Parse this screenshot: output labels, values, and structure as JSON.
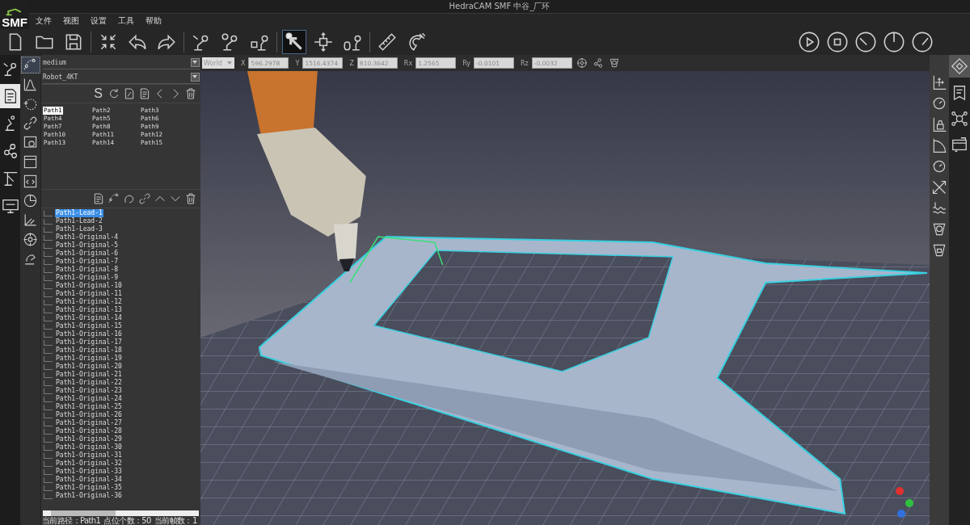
{
  "window": {
    "title": "HedraCAM SMF 中谷_厂环",
    "logo": "SMF"
  },
  "menu": [
    "文件",
    "视图",
    "设置",
    "工具",
    "帮助"
  ],
  "toolbar": [
    {
      "selected": false
    },
    {
      "selected": false
    },
    {
      "selected": false
    },
    {
      "selected": false
    },
    {
      "selected": false
    },
    {
      "selected": false
    },
    {
      "selected": false
    },
    {
      "selected": false
    },
    {
      "selected": false
    },
    {
      "selected": true
    },
    {
      "selected": false
    },
    {
      "selected": false
    },
    {
      "selected": false
    },
    {
      "selected": false
    }
  ],
  "left_rail": [
    {
      "selected": false
    },
    {
      "selected": true
    },
    {
      "selected": false
    },
    {
      "selected": false
    },
    {
      "selected": false
    },
    {
      "selected": false
    }
  ],
  "coords": {
    "frame": "World",
    "fields": [
      {
        "label": "X",
        "value": "596.2978"
      },
      {
        "label": "Y",
        "value": "1516.4374"
      },
      {
        "label": "Z",
        "value": "810.3642"
      },
      {
        "label": "Rx",
        "value": "1.2565"
      },
      {
        "label": "Ry",
        "value": "-0.0101"
      },
      {
        "label": "Rz",
        "value": "-0.0032"
      }
    ]
  },
  "panel": {
    "program": "medium",
    "robot": "Robot_4KT",
    "path_tool_label": "S",
    "paths": [
      {
        "label": "Path1",
        "selected": true
      },
      {
        "label": "Path2",
        "selected": false
      },
      {
        "label": "Path3",
        "selected": false
      },
      {
        "label": "Path4",
        "selected": false
      },
      {
        "label": "Path5",
        "selected": false
      },
      {
        "label": "Path6",
        "selected": false
      },
      {
        "label": "Path7",
        "selected": false
      },
      {
        "label": "Path8",
        "selected": false
      },
      {
        "label": "Path9",
        "selected": false
      },
      {
        "label": "Path10",
        "selected": false
      },
      {
        "label": "Path11",
        "selected": false
      },
      {
        "label": "Path12",
        "selected": false
      },
      {
        "label": "Path13",
        "selected": false
      },
      {
        "label": "Path14",
        "selected": false
      },
      {
        "label": "Path15",
        "selected": false
      }
    ],
    "points": [
      {
        "label": "Path1-Lead-1",
        "selected": true
      },
      {
        "label": "Path1-Lead-2",
        "selected": false
      },
      {
        "label": "Path1-Lead-3",
        "selected": false
      },
      {
        "label": "Path1-Original-4",
        "selected": false
      },
      {
        "label": "Path1-Original-5",
        "selected": false
      },
      {
        "label": "Path1-Original-6",
        "selected": false
      },
      {
        "label": "Path1-Original-7",
        "selected": false
      },
      {
        "label": "Path1-Original-8",
        "selected": false
      },
      {
        "label": "Path1-Original-9",
        "selected": false
      },
      {
        "label": "Path1-Original-10",
        "selected": false
      },
      {
        "label": "Path1-Original-11",
        "selected": false
      },
      {
        "label": "Path1-Original-12",
        "selected": false
      },
      {
        "label": "Path1-Original-13",
        "selected": false
      },
      {
        "label": "Path1-Original-14",
        "selected": false
      },
      {
        "label": "Path1-Original-15",
        "selected": false
      },
      {
        "label": "Path1-Original-16",
        "selected": false
      },
      {
        "label": "Path1-Original-17",
        "selected": false
      },
      {
        "label": "Path1-Original-18",
        "selected": false
      },
      {
        "label": "Path1-Original-19",
        "selected": false
      },
      {
        "label": "Path1-Original-20",
        "selected": false
      },
      {
        "label": "Path1-Original-21",
        "selected": false
      },
      {
        "label": "Path1-Original-22",
        "selected": false
      },
      {
        "label": "Path1-Original-23",
        "selected": false
      },
      {
        "label": "Path1-Original-24",
        "selected": false
      },
      {
        "label": "Path1-Original-25",
        "selected": false
      },
      {
        "label": "Path1-Original-26",
        "selected": false
      },
      {
        "label": "Path1-Original-27",
        "selected": false
      },
      {
        "label": "Path1-Original-28",
        "selected": false
      },
      {
        "label": "Path1-Original-29",
        "selected": false
      },
      {
        "label": "Path1-Original-30",
        "selected": false
      },
      {
        "label": "Path1-Original-31",
        "selected": false
      },
      {
        "label": "Path1-Original-32",
        "selected": false
      },
      {
        "label": "Path1-Original-33",
        "selected": false
      },
      {
        "label": "Path1-Original-34",
        "selected": false
      },
      {
        "label": "Path1-Original-35",
        "selected": false
      },
      {
        "label": "Path1-Original-36",
        "selected": false
      }
    ]
  },
  "status": [
    "当前路径：Path1",
    "点位个数：50",
    "当前帧数：1"
  ]
}
